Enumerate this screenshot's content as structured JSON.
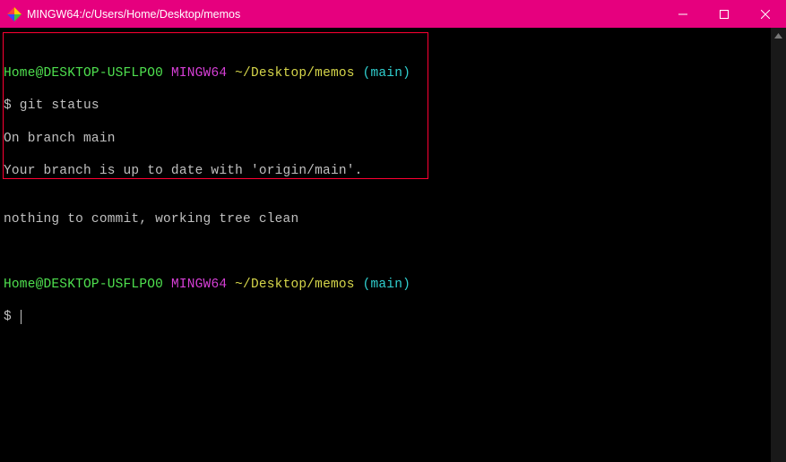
{
  "titlebar": {
    "title": "MINGW64:/c/Users/Home/Desktop/memos"
  },
  "terminal": {
    "prompt1": {
      "user": "Home@DESKTOP-USFLPO0",
      "host": "MINGW64",
      "path": "~/Desktop/memos",
      "branch": "(main)"
    },
    "command1": "$ git status",
    "output1_line1": "On branch main",
    "output1_line2": "Your branch is up to date with 'origin/main'.",
    "output1_line3": "",
    "output1_line4": "nothing to commit, working tree clean",
    "prompt2": {
      "user": "Home@DESKTOP-USFLPO0",
      "host": "MINGW64",
      "path": "~/Desktop/memos",
      "branch": "(main)"
    },
    "command2_prefix": "$ "
  }
}
